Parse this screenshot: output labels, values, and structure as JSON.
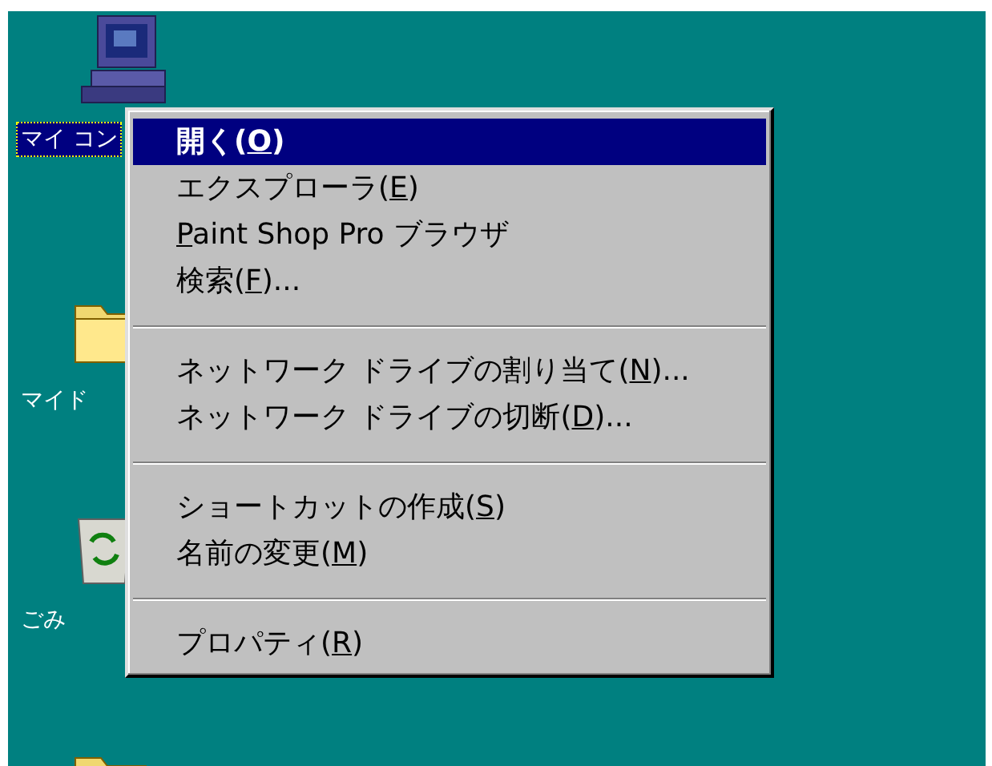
{
  "desktop_icons": [
    {
      "kind": "computer",
      "label": "マイ コン",
      "selected": true
    },
    {
      "kind": "folder",
      "label": "マイド",
      "selected": false
    },
    {
      "kind": "recycle",
      "label": "ごみ",
      "selected": false
    },
    {
      "kind": "folder"
    }
  ],
  "context_menu": {
    "groups": [
      [
        {
          "text_before": "開く(",
          "mnemonic": "O",
          "text_after": ")",
          "default": true,
          "selected": true
        },
        {
          "text_before": "エクスプローラ(",
          "mnemonic": "E",
          "text_after": ")",
          "default": false,
          "selected": false
        },
        {
          "mnemonic": "P",
          "text_after": "aint Shop Pro ブラウザ",
          "default": false,
          "selected": false
        },
        {
          "text_before": "検索(",
          "mnemonic": "F",
          "text_after": ")...",
          "default": false,
          "selected": false
        }
      ],
      [
        {
          "text_before": "ネットワーク ドライブの割り当て(",
          "mnemonic": "N",
          "text_after": ")...",
          "default": false,
          "selected": false
        },
        {
          "text_before": "ネットワーク ドライブの切断(",
          "mnemonic": "D",
          "text_after": ")...",
          "default": false,
          "selected": false
        }
      ],
      [
        {
          "text_before": "ショートカットの作成(",
          "mnemonic": "S",
          "text_after": ")",
          "default": false,
          "selected": false
        },
        {
          "text_before": "名前の変更(",
          "mnemonic": "M",
          "text_after": ")",
          "default": false,
          "selected": false
        }
      ],
      [
        {
          "text_before": "プロパティ(",
          "mnemonic": "R",
          "text_after": ")",
          "default": false,
          "selected": false
        }
      ]
    ]
  }
}
